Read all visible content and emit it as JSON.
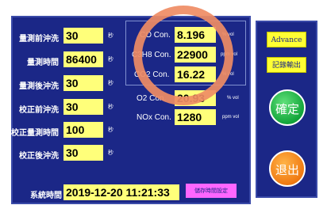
{
  "left_params": [
    {
      "label": "量測前沖洗",
      "value": "30",
      "unit": "秒"
    },
    {
      "label": "量測時間",
      "value": "86400",
      "unit": "秒"
    },
    {
      "label": "量測後沖洗",
      "value": "30",
      "unit": "秒"
    },
    {
      "label": "校正前沖洗",
      "value": "30",
      "unit": "秒"
    },
    {
      "label": "校正量測時間",
      "value": "100",
      "unit": "秒"
    },
    {
      "label": "校正後沖洗",
      "value": "30",
      "unit": "秒"
    }
  ],
  "gas": {
    "co": {
      "label": "CO Con.",
      "value": "8.196",
      "unit": "% vol"
    },
    "c3h8": {
      "label": "C3H8 Con.",
      "value": "22900",
      "unit": "ppm vol"
    },
    "co2": {
      "label": "CO2 Con.",
      "value": "16.22",
      "unit": "% vol"
    },
    "o2": {
      "label": "O2 Con.",
      "value": "20.93",
      "unit": "% vol"
    },
    "nox": {
      "label": "NOx Con.",
      "value": "1280",
      "unit": "ppm vol"
    }
  },
  "system_time": {
    "label": "系統時間",
    "value": "2019-12-20 11:21:33"
  },
  "buttons": {
    "save_time": "儲存時間設定",
    "advance": "Advance",
    "record_output": "記錄輸出",
    "confirm": "確定",
    "exit": "退出"
  },
  "colors": {
    "panel": "#1b2787",
    "field": "#ffff7a",
    "confirm": "#13a53a",
    "exit": "#f07a12",
    "save_button": "#ff66ff",
    "highlight_ring": "#ef8c64"
  }
}
